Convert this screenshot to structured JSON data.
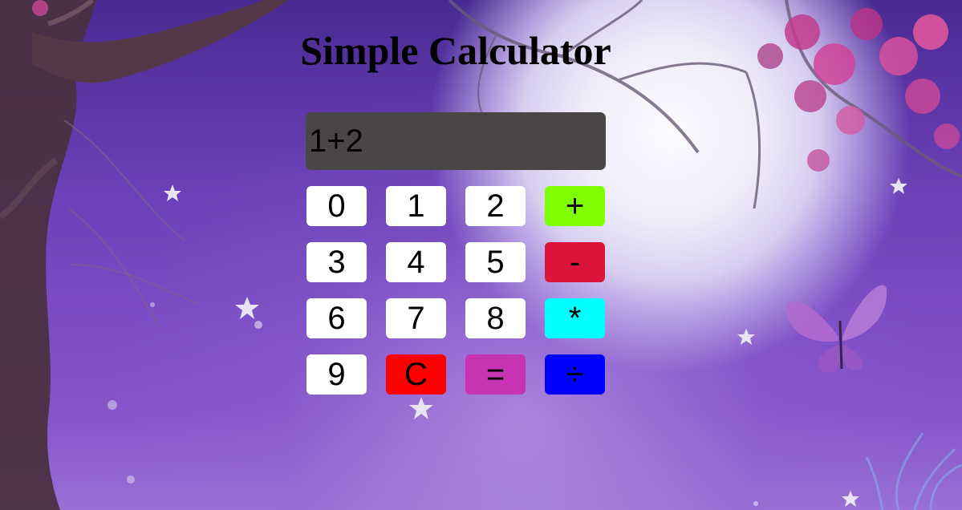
{
  "page": {
    "title": "Simple Calculator"
  },
  "display": {
    "value": "1+2"
  },
  "keys": [
    {
      "label": "0",
      "color": "#ffffff"
    },
    {
      "label": "1",
      "color": "#ffffff"
    },
    {
      "label": "2",
      "color": "#ffffff"
    },
    {
      "label": "+",
      "color": "#7fff00"
    },
    {
      "label": "3",
      "color": "#ffffff"
    },
    {
      "label": "4",
      "color": "#ffffff"
    },
    {
      "label": "5",
      "color": "#ffffff"
    },
    {
      "label": "-",
      "color": "#dc143c"
    },
    {
      "label": "6",
      "color": "#ffffff"
    },
    {
      "label": "7",
      "color": "#ffffff"
    },
    {
      "label": "8",
      "color": "#ffffff"
    },
    {
      "label": "*",
      "color": "#00ffff"
    },
    {
      "label": "9",
      "color": "#ffffff"
    },
    {
      "label": "C",
      "color": "#ff0000"
    },
    {
      "label": "=",
      "color": "#c634b4"
    },
    {
      "label": "÷",
      "color": "#0000ff"
    }
  ],
  "colors": {
    "display_background": "#4b4646",
    "background_top": "#4a2a92",
    "background_bottom": "#9a6fd6",
    "moon": "#f0edfb"
  }
}
